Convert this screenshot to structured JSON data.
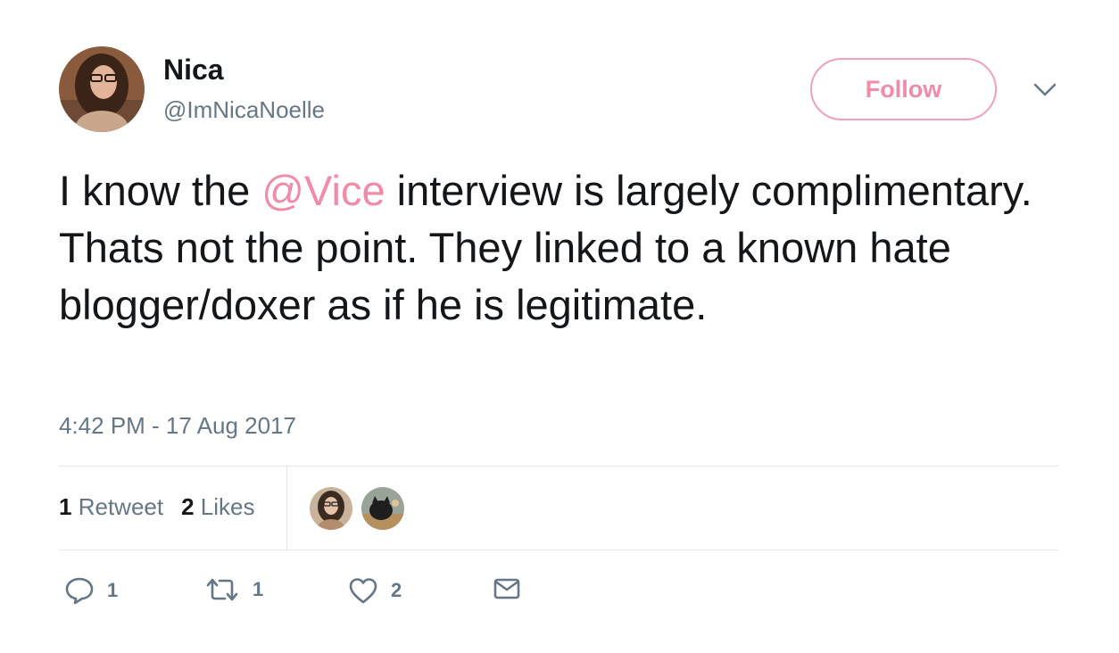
{
  "user": {
    "name": "Nica",
    "handle": "@ImNicaNoelle"
  },
  "follow_label": "Follow",
  "tweet": {
    "text_before": "I know the ",
    "mention": "@Vice",
    "text_after": " interview is largely complimentary. Thats not the point. They linked to a known hate blogger/doxer as if he is legitimate."
  },
  "timestamp": "4:42 PM - 17 Aug 2017",
  "stats": {
    "retweets_count": "1",
    "retweets_label": "Retweet",
    "likes_count": "2",
    "likes_label": "Likes"
  },
  "actions": {
    "reply_count": "1",
    "retweet_count": "1",
    "like_count": "2"
  },
  "icons": {
    "more": "chevron-down-icon",
    "reply": "reply-icon",
    "retweet": "retweet-icon",
    "like": "heart-icon",
    "dm": "envelope-icon"
  },
  "colors": {
    "accent": "#f08ba8",
    "text": "#14171a",
    "secondary": "#657786",
    "divider": "#e1e8ed"
  }
}
